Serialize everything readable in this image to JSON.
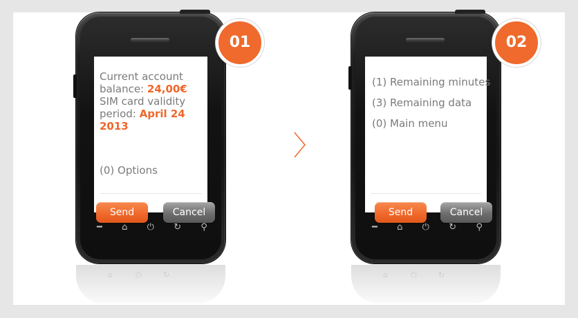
{
  "steps": [
    {
      "badge": "01",
      "balance_line1": "Current account",
      "balance_label": "balance: ",
      "balance_value": "24,00€",
      "validity_line": "SIM card validity",
      "period_label": "period: ",
      "period_value": "April 24 2013",
      "option": "(0) Options",
      "send_label": "Send",
      "cancel_label": "Cancel"
    },
    {
      "badge": "02",
      "options": [
        "(1) Remaining minutes",
        "(3) Remaining data",
        "(0) Main menu"
      ],
      "send_label": "Send",
      "cancel_label": "Cancel"
    }
  ],
  "nav_icons": [
    "call-icon",
    "home-icon",
    "power-icon",
    "back-icon",
    "search-icon"
  ],
  "nav_glyphs": [
    "━",
    "⌂",
    "⏻",
    "↻",
    "⚲"
  ],
  "colors": {
    "accent": "#f0662a",
    "cancel": "#6e6e6e",
    "text": "#7a7a7a",
    "background": "#e6e6e6"
  }
}
